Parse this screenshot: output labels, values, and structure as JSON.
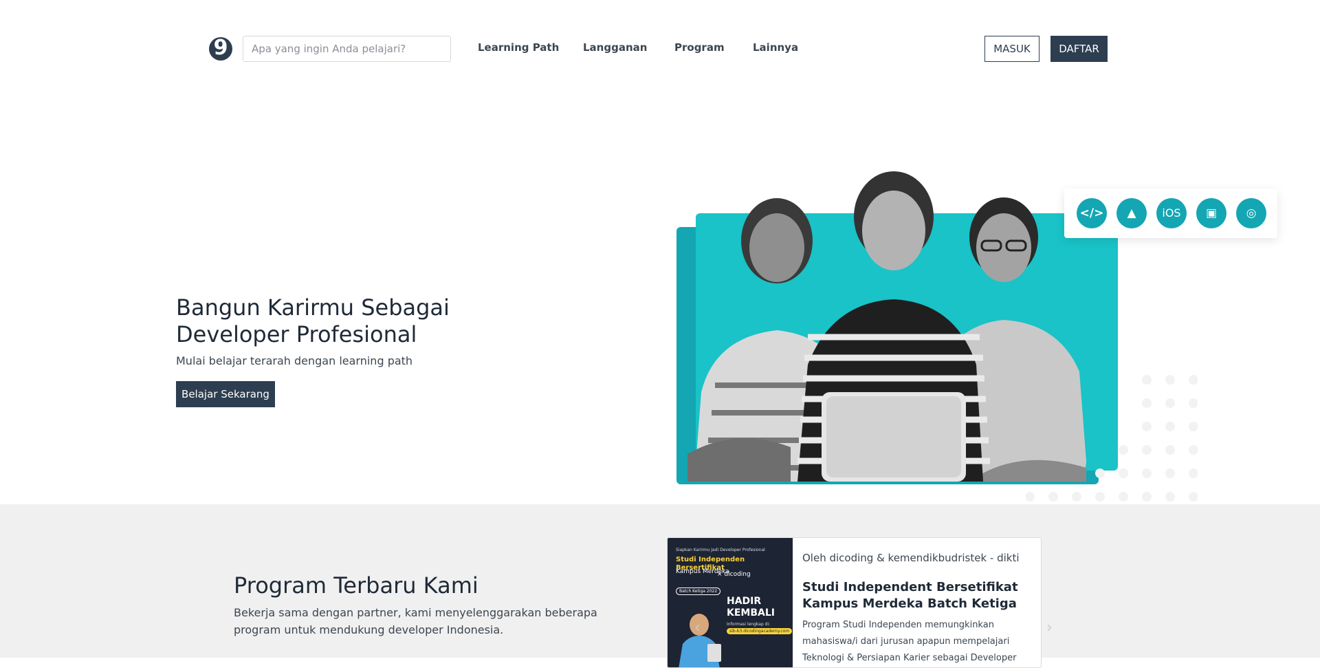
{
  "header": {
    "logo_glyph": "9",
    "search_placeholder": "Apa yang ingin Anda pelajari?",
    "nav": [
      {
        "label": "Learning Path"
      },
      {
        "label": "Langganan"
      },
      {
        "label": "Program"
      },
      {
        "label": "Lainnya"
      }
    ],
    "login_label": "MASUK",
    "register_label": "DAFTAR"
  },
  "hero": {
    "title": "Bangun Karirmu Sebagai Developer Profesional",
    "subtitle": "Mulai belajar terarah dengan learning path",
    "cta_label": "Belajar Sekarang",
    "tech_icons": [
      {
        "name": "code-icon",
        "glyph": "</>"
      },
      {
        "name": "android-icon",
        "glyph": "▲"
      },
      {
        "name": "ios-icon",
        "glyph": "iOS"
      },
      {
        "name": "chip-icon",
        "glyph": "▣"
      },
      {
        "name": "globe-icon",
        "glyph": "◎"
      }
    ]
  },
  "programs": {
    "title": "Program Terbaru Kami",
    "description": "Bekerja sama dengan partner, kami menyelenggarakan beberapa program untuk mendukung developer Indonesia.",
    "card": {
      "org": "Oleh dicoding & kemendikbudristek - dikti",
      "title": "Studi Independent Bersetifikat Kampus Merdeka Batch Ketiga",
      "description": "Program Studi Independen memungkinkan mahasiswa/i dari jurusan apapun mempelajari Teknologi & Persiapan Karier sebagai Developer",
      "poster": {
        "small": "Siapkan Karirmu Jadi Developer Profesional",
        "title": "Studi Independen Bersertifikat",
        "kampus": "Kampus Merdeka",
        "partner": "× dicoding",
        "batch": "Batch Ketiga 2022",
        "headline": "HADIR KEMBALI",
        "info": "Informasi lengkap di:",
        "url": "sib-b3.dicodingacademy.com"
      }
    }
  },
  "colors": {
    "primary": "#2d3e50",
    "teal": "#19c3c7",
    "teal_dark": "#14a6b3",
    "section_bg": "#f0f0f0"
  }
}
